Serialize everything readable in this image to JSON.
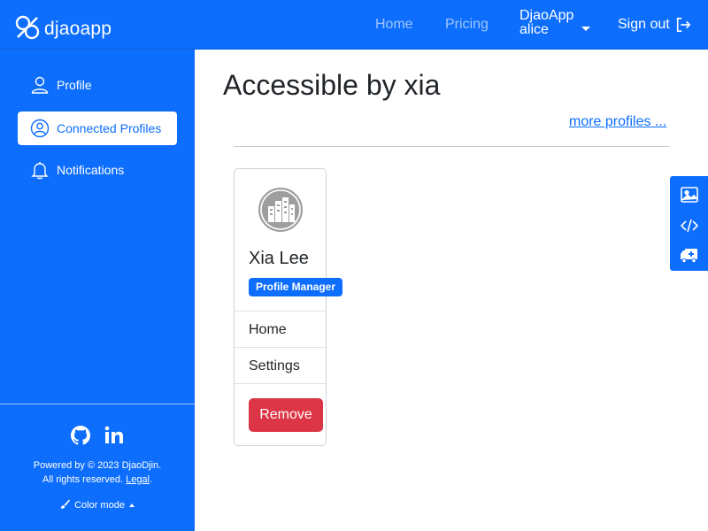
{
  "topbar": {
    "brand": "djaoapp",
    "nav": {
      "home": "Home",
      "pricing": "Pricing"
    },
    "user": {
      "app": "DjaoApp",
      "name": "alice"
    },
    "sign_out": "Sign out"
  },
  "sidebar": {
    "items": [
      {
        "label": "Profile",
        "icon": "user-icon"
      },
      {
        "label": "Connected Profiles",
        "icon": "user-circle-icon",
        "active": true
      },
      {
        "label": "Notifications",
        "icon": "bell-icon"
      }
    ],
    "social": [
      "github-icon",
      "linkedin-icon"
    ],
    "footer": {
      "powered_line1": "Powered by © 2023 DjaoDjin.",
      "powered_line2": "All rights reserved.",
      "legal": "Legal",
      "legal_suffix": "."
    },
    "color_mode": "Color mode"
  },
  "main": {
    "title": "Accessible by xia",
    "more_profiles": "more profiles ..."
  },
  "card": {
    "name": "Xia Lee",
    "badge": "Profile Manager",
    "links": [
      "Home",
      "Settings"
    ],
    "remove": "Remove"
  },
  "colors": {
    "primary": "#0d6efd",
    "danger": "#dc3545"
  }
}
